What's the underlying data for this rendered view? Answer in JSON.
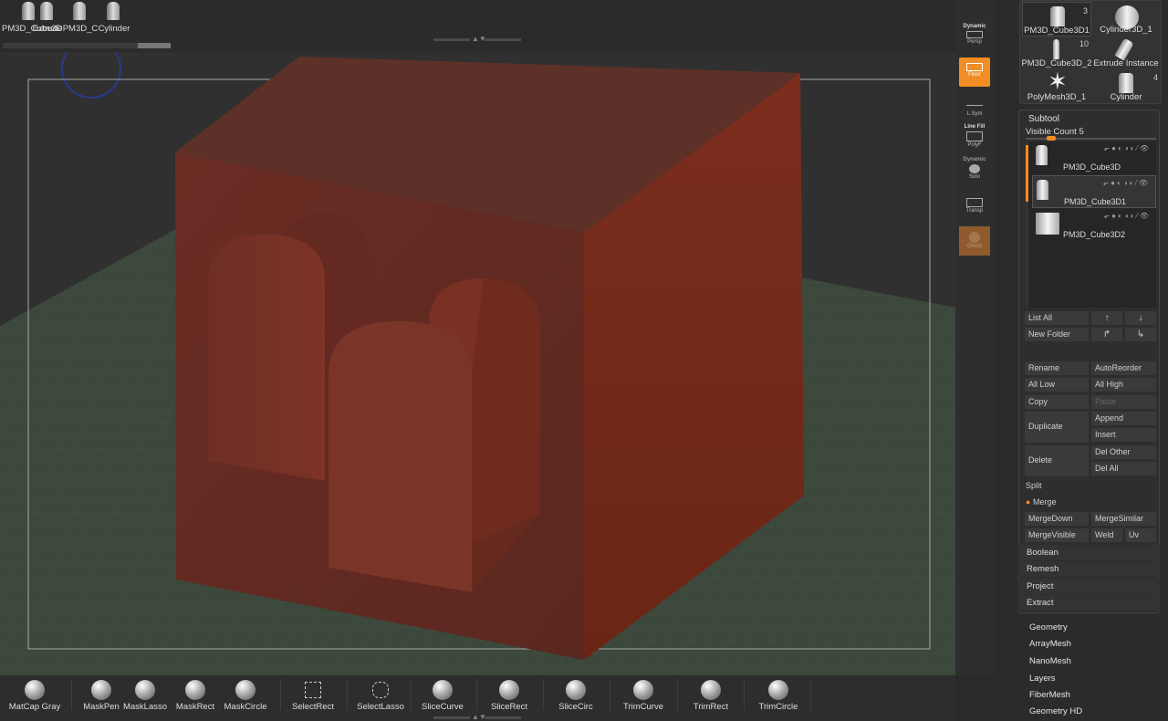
{
  "top_strip": {
    "tools": [
      {
        "label": "PM3D_Cube3D"
      },
      {
        "label": "Extrude"
      },
      {
        "label": "PM3D_C"
      },
      {
        "label": "Cylinder"
      }
    ]
  },
  "shelf": {
    "persp": {
      "title": "Dynamic",
      "sub": "Persp"
    },
    "floor": {
      "sub": "Floor"
    },
    "lsym": {
      "sub": "L.Sym"
    },
    "linefill": {
      "title": "Line Fill",
      "sub": "PolyF"
    },
    "solo": {
      "title": "Dynamic",
      "sub": "Solo"
    },
    "transp": {
      "sub": "Transp"
    },
    "ghost": {
      "sub": "Ghost"
    }
  },
  "tool_thumbs": [
    {
      "label": "PM3D_Cube3D1",
      "count": "3",
      "shape": "cylinder-icon"
    },
    {
      "label": "Cylinder3D_1",
      "count": "",
      "shape": "sphere-icon"
    },
    {
      "label": "PM3D_Cube3D_2",
      "count": "10",
      "shape": "cylinder-icon"
    },
    {
      "label": "Extrude Instance",
      "count": "",
      "shape": "extrude-icon"
    },
    {
      "label": "PolyMesh3D_1",
      "count": "",
      "shape": "star-icon"
    },
    {
      "label": "Cylinder",
      "count": "4",
      "shape": "cylinder-icon"
    }
  ],
  "subtool": {
    "title": "Subtool",
    "visible_count_label": "Visible Count",
    "visible_count": "5",
    "items": [
      {
        "name": "PM3D_Cube3D"
      },
      {
        "name": "PM3D_Cube3D1"
      },
      {
        "name": "PM3D_Cube3D2"
      }
    ],
    "row_icons": "⬐●◐◑◐⁄👁",
    "buttons": {
      "list_all": "List All",
      "new_folder": "New Folder",
      "up_arrow": "↑",
      "down_arrow": "↓",
      "move_up": "↱",
      "move_down": "↳",
      "rename": "Rename",
      "auto_reorder": "AutoReorder",
      "all_low": "All Low",
      "all_high": "All High",
      "copy": "Copy",
      "paste": "Paste",
      "duplicate": "Duplicate",
      "append": "Append",
      "insert": "Insert",
      "delete": "Delete",
      "del_other": "Del Other",
      "del_all": "Del All",
      "merge_down": "MergeDown",
      "merge_similar": "MergeSimilar",
      "merge_visible": "MergeVisible",
      "weld": "Weld",
      "uv": "Uv"
    },
    "sections": {
      "split": "Split",
      "merge": "Merge",
      "boolean": "Boolean",
      "remesh": "Remesh",
      "project": "Project",
      "extract": "Extract"
    }
  },
  "menus": [
    "Geometry",
    "ArrayMesh",
    "NanoMesh",
    "Layers",
    "FiberMesh",
    "Geometry HD"
  ],
  "bottom_bar": [
    {
      "label": "MatCap Gray",
      "glyph": "matcap-sphere-icon"
    },
    {
      "label": "MaskPen",
      "glyph": "mask-pen-icon"
    },
    {
      "label": "MaskLasso",
      "glyph": "mask-lasso-icon"
    },
    {
      "label": "MaskRect",
      "glyph": "mask-rect-icon"
    },
    {
      "label": "MaskCircle",
      "glyph": "mask-circle-icon"
    },
    {
      "label": "SelectRect",
      "glyph": "select-rect-icon"
    },
    {
      "label": "SelectLasso",
      "glyph": "select-lasso-icon"
    },
    {
      "label": "SliceCurve",
      "glyph": "slice-curve-icon"
    },
    {
      "label": "SliceRect",
      "glyph": "slice-rect-icon"
    },
    {
      "label": "SliceCirc",
      "glyph": "slice-circ-icon"
    },
    {
      "label": "TrimCurve",
      "glyph": "trim-curve-icon"
    },
    {
      "label": "TrimRect",
      "glyph": "trim-rect-icon"
    },
    {
      "label": "TrimCircle",
      "glyph": "trim-circle-icon"
    }
  ],
  "colors": {
    "accent": "#f28c24",
    "mesh": "#8a2f22",
    "floor_grid": "#3e4a3d"
  }
}
